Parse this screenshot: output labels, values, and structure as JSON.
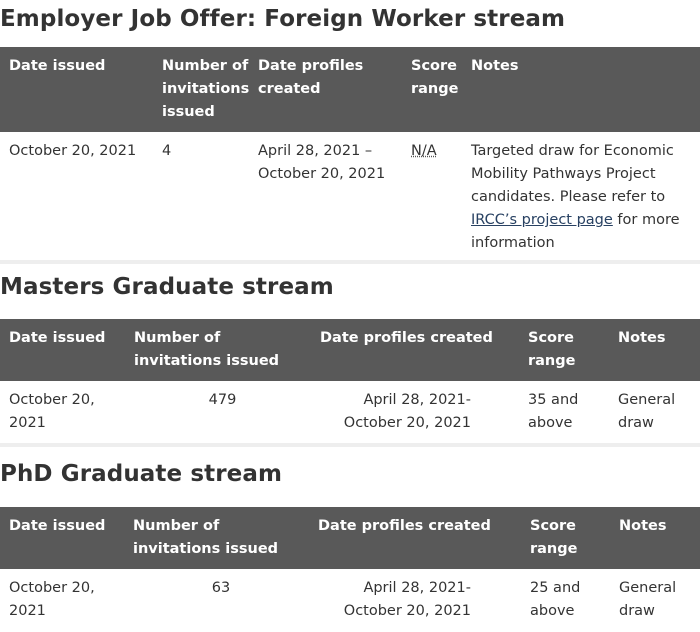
{
  "employer": {
    "title": "Employer Job Offer: Foreign Worker stream",
    "headers": {
      "date_issued": "Date issued",
      "invitations": "Number of invitations issued",
      "profiles_created": "Date profiles created",
      "score_range": "Score range",
      "notes": "Notes"
    },
    "row": {
      "date_issued": "October 20, 2021",
      "invitations": "4",
      "profiles_created": "April 28, 2021 – October 20, 2021",
      "score_range": "N/A",
      "notes_before": "Targeted draw for Economic Mobility Pathways Project candidates. Please refer to ",
      "notes_link": "IRCC’s project page",
      "notes_after": " for more information"
    }
  },
  "masters": {
    "title": "Masters Graduate stream",
    "headers": {
      "date_issued": "Date issued",
      "invitations": "Number of invitations issued",
      "profiles_created": "Date profiles created",
      "score_range": "Score range",
      "notes": "Notes"
    },
    "row": {
      "date_issued": "October 20, 2021",
      "invitations": "479",
      "profiles_created": "April 28, 2021- October 20, 2021",
      "score_range": "35 and above",
      "notes": "General draw"
    }
  },
  "phd": {
    "title": "PhD Graduate stream",
    "headers": {
      "date_issued": "Date issued",
      "invitations": "Number of invitations issued",
      "profiles_created": "Date profiles created",
      "score_range": "Score range",
      "notes": "Notes"
    },
    "row": {
      "date_issued": "October 20, 2021",
      "invitations": "63",
      "profiles_created": "April 28, 2021- October 20, 2021",
      "score_range": "25 and above",
      "notes": "General draw"
    }
  },
  "colors": {
    "header_bg": "#595959",
    "header_text": "#ffffff",
    "body_text": "#333333",
    "link": "#284162",
    "row_divider": "#eeeeee"
  }
}
